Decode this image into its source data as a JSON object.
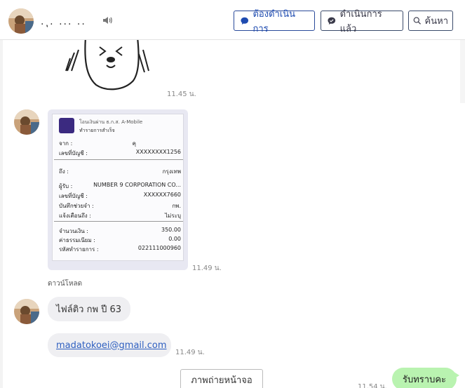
{
  "header": {
    "contact_name": ". ุ. ... ..",
    "buttons": {
      "todo": "ต้องดำเนินการ",
      "done": "ดำเนินการแล้ว",
      "search": "ค้นหา"
    }
  },
  "colors": {
    "accent_blue": "#1e4bb0",
    "outgoing_bubble": "#b9f3b0",
    "incoming_bubble": "#efeff2",
    "link": "#2e5fc0"
  },
  "icons": {
    "speaker": "speaker-icon",
    "todo": "todo-bubble-icon",
    "done": "chat-check-icon",
    "search": "search-icon"
  },
  "messages": {
    "sticker_time": "11.45 น.",
    "receipt": {
      "title": "โอนเงินผ่าน ธ.ก.ส. A-Mobile",
      "subtitle": "ทำรายการสำเร็จ",
      "from_label": "จาก :",
      "from_value": "คุ",
      "account_label": "เลขที่บัญชี :",
      "account_value": "XXXXXXXX1256",
      "to_label": "ถึง :",
      "to_value": "กรุงเทพ",
      "recipient_label": "ผู้รับ :",
      "recipient_value": "NUMBER 9 CORPORATION CO...",
      "to_account_label": "เลขที่บัญชี :",
      "to_account_value": "XXXXXX7660",
      "memo_label": "บันทึกช่วยจำ :",
      "memo_value": "กพ.",
      "notify_label": "แจ้งเตือนถึง :",
      "notify_value": "ไม่ระบุ",
      "amount_label": "จำนวนเงิน :",
      "amount_value": "350.00",
      "fee_label": "ค่าธรรมเนียม :",
      "fee_value": "0.00",
      "ref_label": "รหัสทำรายการ :",
      "ref_value": "022111000960",
      "time": "11.49 น.",
      "download": "ดาวน์โหลด"
    },
    "text1": "ไฟล์ติว กพ ปี 63",
    "email": "madatokoei@gmail.com",
    "email_time": "11.49 น.",
    "screenshot_button": "ภาพถ่ายหน้าจอ",
    "reply": "รับทราบคะ",
    "reply_time": "11.54 น."
  }
}
